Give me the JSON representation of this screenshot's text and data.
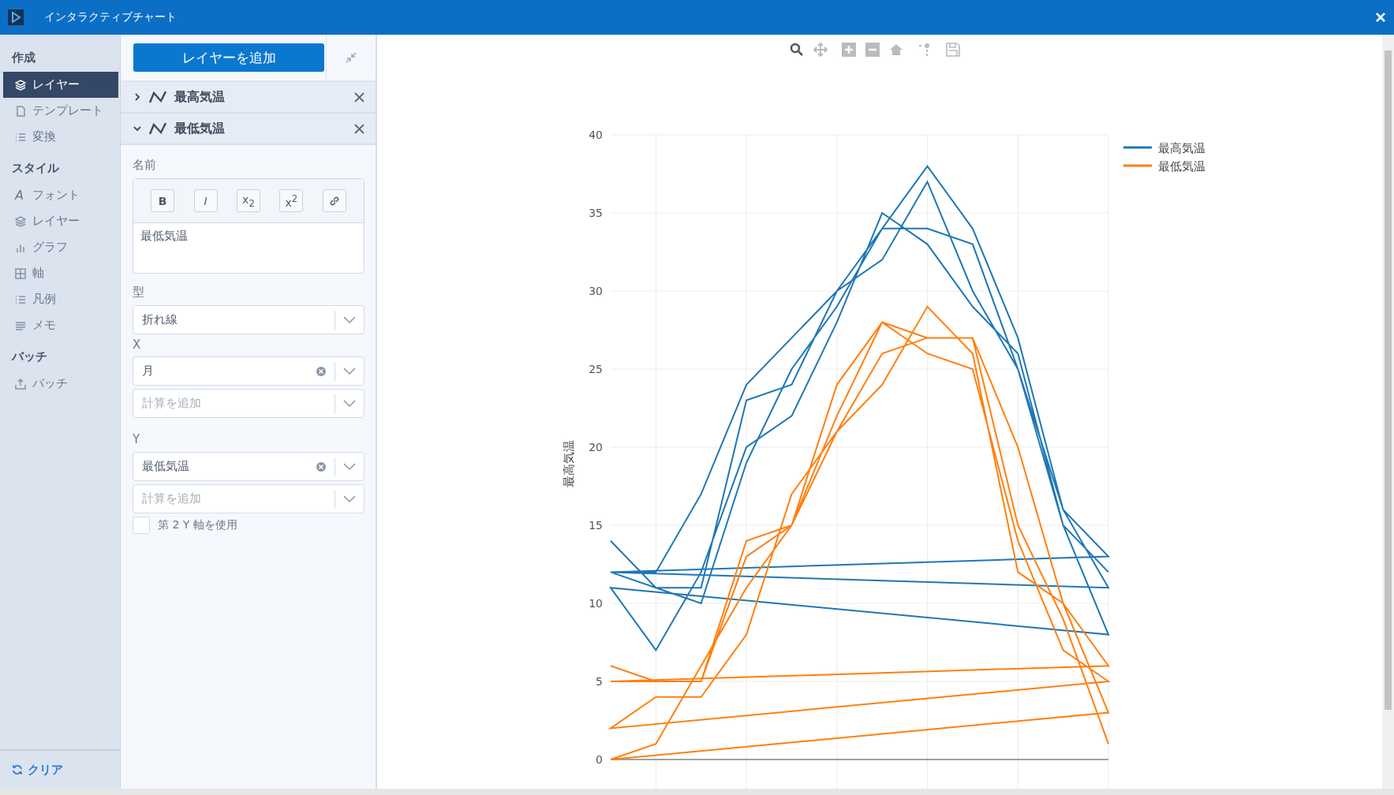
{
  "window": {
    "title": "インタラクティブチャート"
  },
  "sidebar": {
    "sections": [
      {
        "title": "作成",
        "items": [
          {
            "label": "レイヤー",
            "kind": "layers",
            "selected": true
          },
          {
            "label": "テンプレート",
            "kind": "file",
            "selected": false
          },
          {
            "label": "変換",
            "kind": "list",
            "selected": false
          }
        ]
      },
      {
        "title": "スタイル",
        "items": [
          {
            "label": "フォント",
            "glyph": "A",
            "kind": "glyph",
            "selected": false
          },
          {
            "label": "レイヤー",
            "kind": "layers",
            "selected": false
          },
          {
            "label": "グラフ",
            "kind": "bars",
            "selected": false
          },
          {
            "label": "軸",
            "kind": "grid",
            "selected": false
          },
          {
            "label": "凡例",
            "kind": "list",
            "selected": false
          },
          {
            "label": "メモ",
            "kind": "lines",
            "selected": false
          }
        ]
      },
      {
        "title": "バッチ",
        "items": [
          {
            "label": "バッチ",
            "kind": "export",
            "selected": false
          }
        ]
      }
    ],
    "footer": "クリア"
  },
  "panel": {
    "add_button": "レイヤーを追加",
    "layers": [
      {
        "name": "最高気温",
        "expanded": false
      },
      {
        "name": "最低気温",
        "expanded": true
      }
    ],
    "name_label": "名前",
    "format_buttons": [
      "B",
      "I",
      "x$_{2}$",
      "x$^{2}$"
    ],
    "name_value": "最低気温",
    "type_label": "型",
    "type_value": "折れ線",
    "x_label": "X",
    "x_value": "月",
    "x_calc_placeholder": "計算を追加",
    "y_label": "Y",
    "y_value": "最低気温",
    "y_calc_placeholder": "計算を追加",
    "secondary_axis": {
      "label": "第 2 Y 軸を使用",
      "checked": false
    }
  },
  "chart": {
    "y_ticks": [
      "40",
      "35",
      "30",
      "25",
      "20",
      "15",
      "10",
      "5",
      "0"
    ],
    "y_title": "最高気温",
    "legend": [
      {
        "label": "最高気温",
        "color": "#1f77b4"
      },
      {
        "label": "最低気温",
        "color": "#ff7f0e"
      }
    ]
  }
}
